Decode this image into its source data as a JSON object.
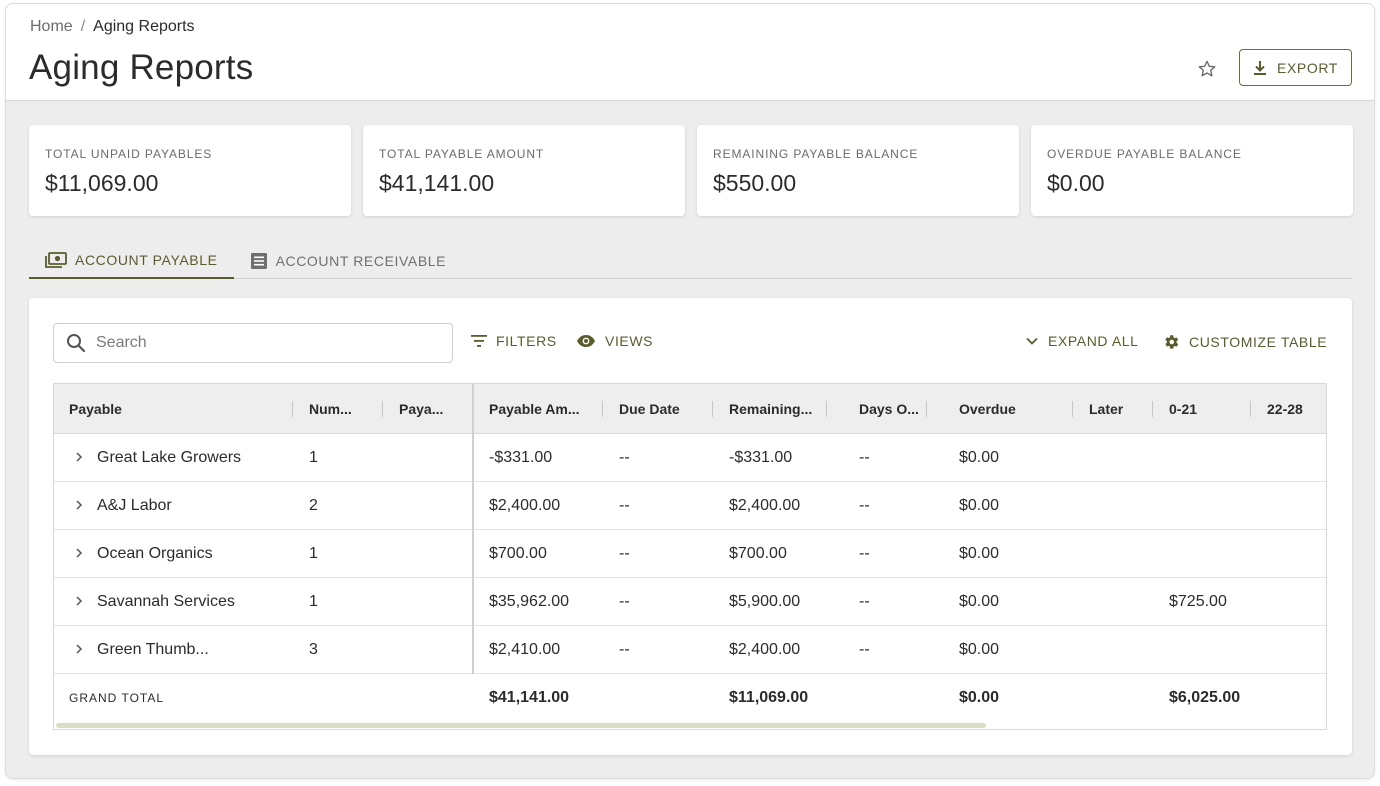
{
  "breadcrumb": {
    "home": "Home",
    "separator": "/",
    "current": "Aging Reports"
  },
  "page": {
    "title": "Aging Reports",
    "favorite_icon": "star-outline-icon"
  },
  "export": {
    "label": "EXPORT",
    "icon": "download-icon"
  },
  "summary": [
    {
      "label": "TOTAL UNPAID PAYABLES",
      "value": "$11,069.00"
    },
    {
      "label": "TOTAL PAYABLE AMOUNT",
      "value": "$41,141.00"
    },
    {
      "label": "REMAINING PAYABLE BALANCE",
      "value": "$550.00"
    },
    {
      "label": "OVERDUE PAYABLE BALANCE",
      "value": "$0.00"
    }
  ],
  "tabs": [
    {
      "label": "ACCOUNT PAYABLE",
      "icon": "money-icon",
      "active": true
    },
    {
      "label": "ACCOUNT RECEIVABLE",
      "icon": "receipt-icon",
      "active": false
    }
  ],
  "toolbar": {
    "search_placeholder": "Search",
    "filters": "FILTERS",
    "views": "VIEWS",
    "expand_all": "EXPAND ALL",
    "customize": "CUSTOMIZE TABLE"
  },
  "table": {
    "columns": [
      "Payable",
      "Num...",
      "Paya...",
      "Payable Am...",
      "Due Date",
      "Remaining...",
      "Days O...",
      "Overdue",
      "Later",
      "0-21",
      "22-28"
    ],
    "rows": [
      {
        "payable": "Great Lake Growers",
        "num": "1",
        "paya": "",
        "amount": "-$331.00",
        "due": "--",
        "remaining": "-$331.00",
        "days": "--",
        "overdue": "$0.00",
        "later": "",
        "d0_21": "",
        "d22_28": ""
      },
      {
        "payable": "A&J Labor",
        "num": "2",
        "paya": "",
        "amount": "$2,400.00",
        "due": "--",
        "remaining": "$2,400.00",
        "days": "--",
        "overdue": "$0.00",
        "later": "",
        "d0_21": "",
        "d22_28": ""
      },
      {
        "payable": "Ocean Organics",
        "num": "1",
        "paya": "",
        "amount": "$700.00",
        "due": "--",
        "remaining": "$700.00",
        "days": "--",
        "overdue": "$0.00",
        "later": "",
        "d0_21": "",
        "d22_28": ""
      },
      {
        "payable": "Savannah Services",
        "num": "1",
        "paya": "",
        "amount": "$35,962.00",
        "due": "--",
        "remaining": "$5,900.00",
        "days": "--",
        "overdue": "$0.00",
        "later": "",
        "d0_21": "$725.00",
        "d22_28": ""
      },
      {
        "payable": "Green Thumb...",
        "num": "3",
        "paya": "",
        "amount": "$2,410.00",
        "due": "--",
        "remaining": "$2,400.00",
        "days": "--",
        "overdue": "$0.00",
        "later": "",
        "d0_21": "",
        "d22_28": ""
      }
    ],
    "total": {
      "label": "GRAND TOTAL",
      "amount": "$41,141.00",
      "remaining": "$11,069.00",
      "overdue": "$0.00",
      "d0_21": "$6,025.00"
    }
  },
  "colors": {
    "accent": "#5a5c2e",
    "page_bg": "#eeedee",
    "header_bg": "#efeeef"
  }
}
